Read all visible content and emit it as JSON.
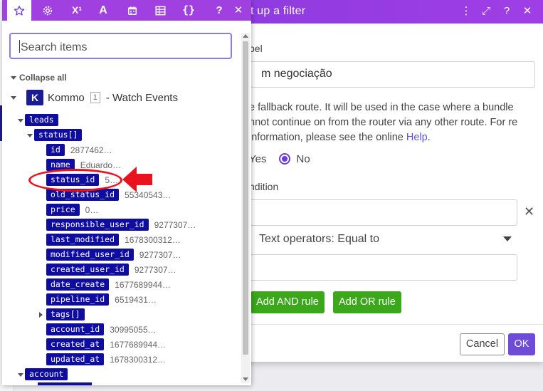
{
  "dialog": {
    "title": "t up a filter",
    "label_caption": "bel",
    "label_value": "m negociação",
    "help_text": "e fallback route. It will be used in the case where a bundle nnot continue on from the router via any other route. For re information, please see the online",
    "help_link": "Help",
    "help_end": ".",
    "radio_yes": "Yes",
    "radio_no": "No",
    "condition_caption": "ndition",
    "operator": "Text operators: Equal to",
    "add_and": "Add AND rule",
    "add_or": "Add OR rule",
    "cancel": "Cancel",
    "ok": "OK",
    "icons": {
      "more": "⋮",
      "expand": "⤢",
      "help": "?",
      "close": "✕"
    },
    "remove": "✕"
  },
  "toolbar": {
    "superscript": "X¹",
    "text": "A",
    "braces": "{}",
    "help": "?",
    "close": "✕"
  },
  "panel": {
    "search_placeholder": "Search items",
    "collapse_all": "Collapse all",
    "module": {
      "logo": "K",
      "name": "Kommo",
      "number": "1",
      "suffix": "- Watch Events"
    },
    "tree": [
      {
        "key": "leads",
        "value": ""
      },
      {
        "key": "status[]",
        "value": ""
      },
      {
        "key": "id",
        "value": "2877462…"
      },
      {
        "key": "name",
        "value": "Eduardo…"
      },
      {
        "key": "status_id",
        "value": "5…"
      },
      {
        "key": "old_status_id",
        "value": "55340543…"
      },
      {
        "key": "price",
        "value": "0…"
      },
      {
        "key": "responsible_user_id",
        "value": "9277307…"
      },
      {
        "key": "last_modified",
        "value": "1678300312…"
      },
      {
        "key": "modified_user_id",
        "value": "9277307…"
      },
      {
        "key": "created_user_id",
        "value": "9277307…"
      },
      {
        "key": "date_create",
        "value": "1677689944…"
      },
      {
        "key": "pipeline_id",
        "value": "6519431…"
      },
      {
        "key": "tags[]",
        "value": ""
      },
      {
        "key": "account_id",
        "value": "30995055…"
      },
      {
        "key": "created_at",
        "value": "1677689944…"
      },
      {
        "key": "updated_at",
        "value": "1678300312…"
      },
      {
        "key": "account",
        "value": ""
      }
    ]
  },
  "colors": {
    "toolbar": "#a040e0",
    "tag": "#0f0ca0",
    "accent": "#6e4cd8",
    "green": "#3aa81a",
    "annotation": "#e8131e"
  }
}
